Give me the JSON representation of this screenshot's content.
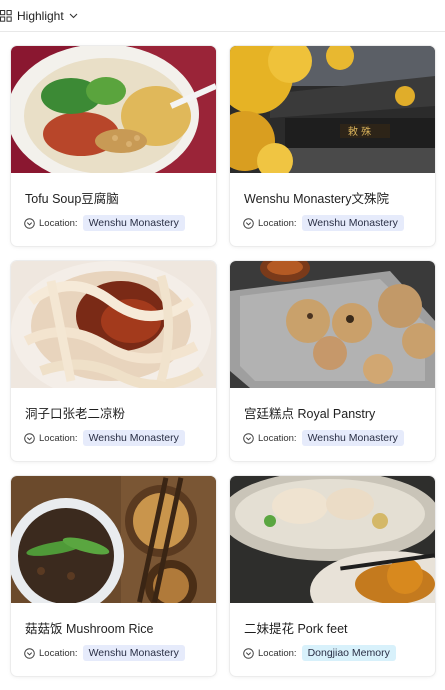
{
  "toolbar": {
    "view_label": "Highlight"
  },
  "cards": [
    {
      "title": "Tofu Soup豆腐脑",
      "location_label": "Location:",
      "location": "Wenshu Monastery"
    },
    {
      "title": "Wenshu Monastery文殊院",
      "location_label": "Location:",
      "location": "Wenshu Monastery"
    },
    {
      "title": "洞子口张老二凉粉",
      "location_label": "Location:",
      "location": "Wenshu Monastery"
    },
    {
      "title": "宫廷糕点 Royal Panstry",
      "location_label": "Location:",
      "location": "Wenshu Monastery"
    },
    {
      "title": "菇菇饭 Mushroom Rice",
      "location_label": "Location:",
      "location": "Wenshu Monastery"
    },
    {
      "title": "二妹提花 Pork feet",
      "location_label": "Location:",
      "location": "Dongjiao Memory"
    }
  ],
  "colors": {
    "tag_default": "#e6ebfb",
    "tag_alt": "#d8f1fb"
  },
  "icons": {
    "view": "grid-icon",
    "dropdown": "chevron-down-icon",
    "location": "clock-circle-icon"
  }
}
